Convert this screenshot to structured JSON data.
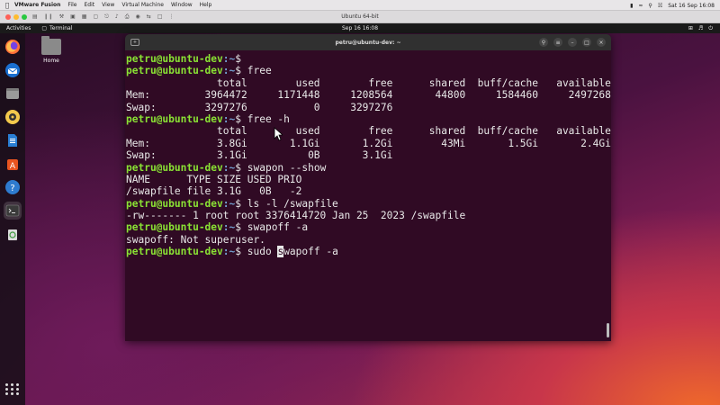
{
  "mac_menubar": {
    "app_name": "VMware Fusion",
    "menus": [
      "File",
      "Edit",
      "View",
      "Virtual Machine",
      "Window",
      "Help"
    ],
    "clock": "Sat 16 Sep 16:08"
  },
  "vmware": {
    "title": "Ubuntu 64-bit"
  },
  "ubuntu_panel": {
    "activities": "Activities",
    "app": "Terminal",
    "clock": "Sep 16  16:08"
  },
  "desktop": {
    "home_label": "Home"
  },
  "terminal": {
    "title": "petru@ubuntu-dev: ~",
    "prompt_user": "petru@ubuntu-dev",
    "prompt_path": ":~",
    "prompt_symbol": "$ ",
    "lines": [
      {
        "type": "prompt",
        "cmd": ""
      },
      {
        "type": "prompt",
        "cmd": "free"
      },
      {
        "type": "out",
        "text": "               total        used        free      shared  buff/cache   available"
      },
      {
        "type": "out",
        "text": "Mem:         3964472     1171448     1208564       44800     1584460     2497268"
      },
      {
        "type": "out",
        "text": "Swap:        3297276           0     3297276"
      },
      {
        "type": "prompt",
        "cmd": "free -h"
      },
      {
        "type": "out",
        "text": "               total        used        free      shared  buff/cache   available"
      },
      {
        "type": "out",
        "text": "Mem:           3.8Gi       1.1Gi       1.2Gi        43Mi       1.5Gi       2.4Gi"
      },
      {
        "type": "out",
        "text": "Swap:          3.1Gi          0B       3.1Gi"
      },
      {
        "type": "prompt",
        "cmd": "swapon --show"
      },
      {
        "type": "out",
        "text": "NAME      TYPE SIZE USED PRIO"
      },
      {
        "type": "out",
        "text": "/swapfile file 3.1G   0B   -2"
      },
      {
        "type": "prompt",
        "cmd": "ls -l /swapfile"
      },
      {
        "type": "out",
        "text": "-rw------- 1 root root 3376414720 Jan 25  2023 /swapfile"
      },
      {
        "type": "prompt",
        "cmd": "swapoff -a"
      },
      {
        "type": "out",
        "text": "swapoff: Not superuser."
      },
      {
        "type": "prompt_cursor",
        "before": "sudo ",
        "cursor_char": "s",
        "after": "wapoff -a"
      }
    ]
  },
  "colors": {
    "terminal_bg": "#300a24",
    "prompt_user": "#8ae234",
    "prompt_path": "#729fcf"
  }
}
